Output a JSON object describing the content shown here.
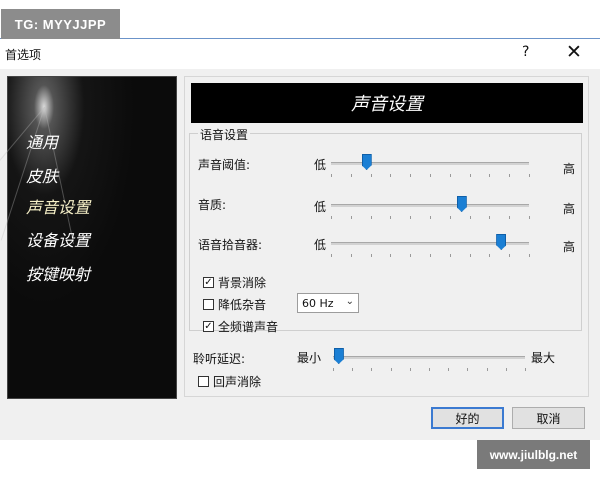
{
  "watermark_top": "TG: MYYJJPP",
  "watermark_bottom": "www.jiulblg.net",
  "window": {
    "title": "首选项",
    "help": "?",
    "close": "✕"
  },
  "nav": {
    "items": [
      "通用",
      "皮肤",
      "声音设置",
      "设备设置",
      "按键映射"
    ],
    "selected_index": 2
  },
  "header": {
    "title": "声音设置"
  },
  "voice_group": {
    "label": "语音设置",
    "sliders": [
      {
        "label": "声音阈值:",
        "low": "低",
        "high": "高",
        "value_fraction": 0.18
      },
      {
        "label": "音质:",
        "low": "低",
        "high": "高",
        "value_fraction": 0.66
      },
      {
        "label": "语音拾音器:",
        "low": "低",
        "high": "高",
        "value_fraction": 0.86
      }
    ],
    "options": [
      {
        "label": "背景消除",
        "checked": true
      },
      {
        "label": "降低杂音",
        "checked": false
      },
      {
        "label": "全频谱声音",
        "checked": true
      }
    ],
    "noise_select": {
      "value": "60 Hz"
    }
  },
  "listen_delay": {
    "label": "聆听延迟:",
    "low": "最小",
    "high": "最大",
    "value_fraction": 0.03
  },
  "echo_cancel": {
    "label": "回声消除",
    "checked": false
  },
  "buttons": {
    "ok": "好的",
    "cancel": "取消"
  },
  "colors": {
    "accent": "#1b7fd4",
    "nav_bg": "#0b0b0b",
    "header_bg": "#000000",
    "border": "#3b7ad1"
  }
}
